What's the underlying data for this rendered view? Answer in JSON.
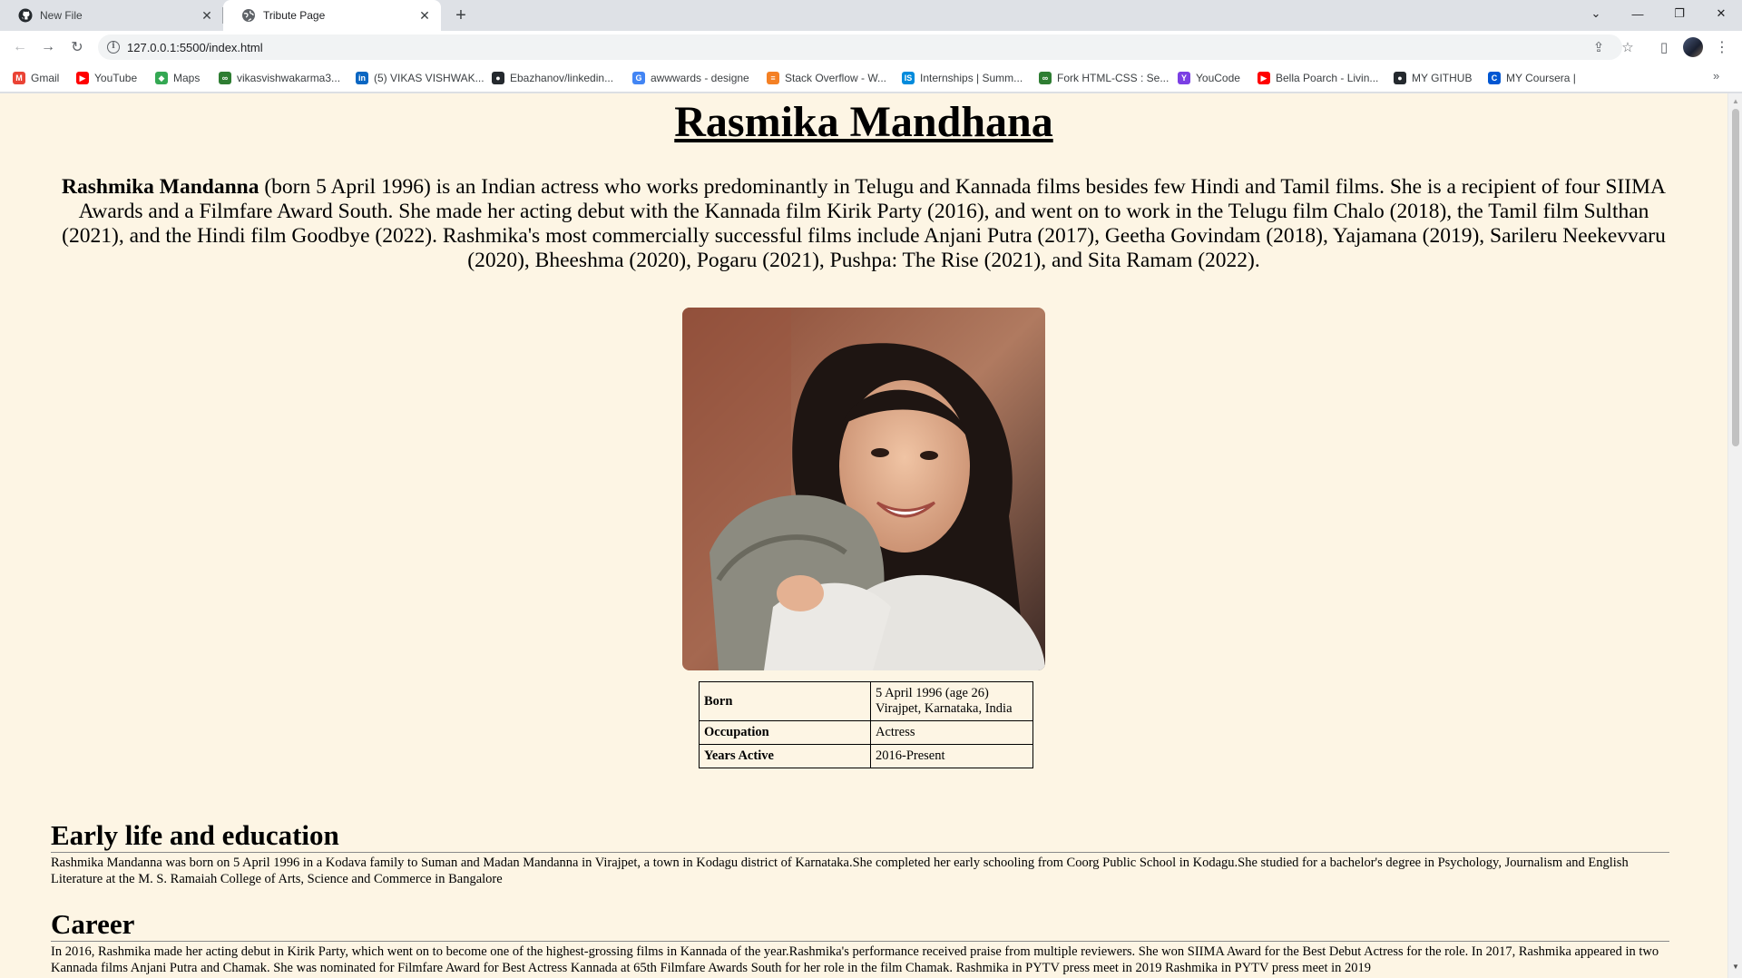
{
  "browser": {
    "tabs": [
      {
        "title": "New File",
        "icon": "github-icon"
      },
      {
        "title": "Tribute Page",
        "icon": "globe-icon"
      }
    ],
    "url": "127.0.0.1:5500/index.html",
    "bookmarks": [
      {
        "label": "Gmail",
        "icon": "gmail-icon",
        "color": "#ea4335"
      },
      {
        "label": "YouTube",
        "icon": "youtube-icon",
        "color": "#ff0000"
      },
      {
        "label": "Maps",
        "icon": "maps-icon",
        "color": "#34a853"
      },
      {
        "label": "vikasvishwakarma3...",
        "icon": "codolio-icon",
        "color": "#2e7d32"
      },
      {
        "label": "(5) VIKAS VISHWAK...",
        "icon": "linkedin-icon",
        "color": "#0a66c2"
      },
      {
        "label": "Ebazhanov/linkedin...",
        "icon": "github-icon",
        "color": "#24292e"
      },
      {
        "label": "awwwards - designe",
        "icon": "google-icon",
        "color": "#4285f4"
      },
      {
        "label": "Stack Overflow - W...",
        "icon": "stackoverflow-icon",
        "color": "#f48024"
      },
      {
        "label": "Internships | Summ...",
        "icon": "internshala-icon",
        "color": "#008bdc"
      },
      {
        "label": "Fork HTML-CSS : Se...",
        "icon": "codolio-icon",
        "color": "#2e7d32"
      },
      {
        "label": "YouCode",
        "icon": "youcode-icon",
        "color": "#7b3fe4"
      },
      {
        "label": "Bella Poarch - Livin...",
        "icon": "youtube-icon",
        "color": "#ff0000"
      },
      {
        "label": "MY GITHUB",
        "icon": "github-icon",
        "color": "#24292e"
      },
      {
        "label": "MY Coursera |",
        "icon": "coursera-icon",
        "color": "#0056d2"
      }
    ]
  },
  "page": {
    "title": "Rasmika Mandhana",
    "intro_name": "Rashmika Mandanna",
    "intro_text": " (born 5 April 1996) is an Indian actress who works predominantly in Telugu and Kannada films besides few Hindi and Tamil films. She is a recipient of four SIIMA Awards and a Filmfare Award South. She made her acting debut with the Kannada film Kirik Party (2016), and went on to work in the Telugu film Chalo (2018), the Tamil film Sulthan (2021), and the Hindi film Goodbye (2022). Rashmika's most commercially successful films include Anjani Putra (2017), Geetha Govindam (2018), Yajamana (2019), Sarileru Neekevvaru (2020), Bheeshma (2020), Pogaru (2021), Pushpa: The Rise (2021), and Sita Ramam (2022).",
    "info": {
      "born_label": "Born",
      "born_date": "5 April 1996 (age 26)",
      "born_place": "Virajpet, Karnataka, India",
      "occupation_label": "Occupation",
      "occupation_value": "Actress",
      "years_label": "Years Active",
      "years_value": "2016-Present"
    },
    "sections": {
      "early_heading": "Early life and education",
      "early_text": "Rashmika Mandanna was born on 5 April 1996 in a Kodava family to Suman and Madan Mandanna in Virajpet, a town in Kodagu district of Karnataka.She completed her early schooling from Coorg Public School in Kodagu.She studied for a bachelor's degree in Psychology, Journalism and English Literature at the M. S. Ramaiah College of Arts, Science and Commerce in Bangalore",
      "career_heading": "Career",
      "career_text": "In 2016, Rashmika made her acting debut in Kirik Party, which went on to become one of the highest-grossing films in Kannada of the year.Rashmika's performance received praise from multiple reviewers. She won SIIMA Award for the Best Debut Actress for the role. In 2017, Rashmika appeared in two Kannada films Anjani Putra and Chamak. She was nominated for Filmfare Award for Best Actress Kannada at 65th Filmfare Awards South for her role in the film Chamak. Rashmika in PYTV press meet in 2019 Rashmika in PYTV press meet in 2019"
    }
  }
}
